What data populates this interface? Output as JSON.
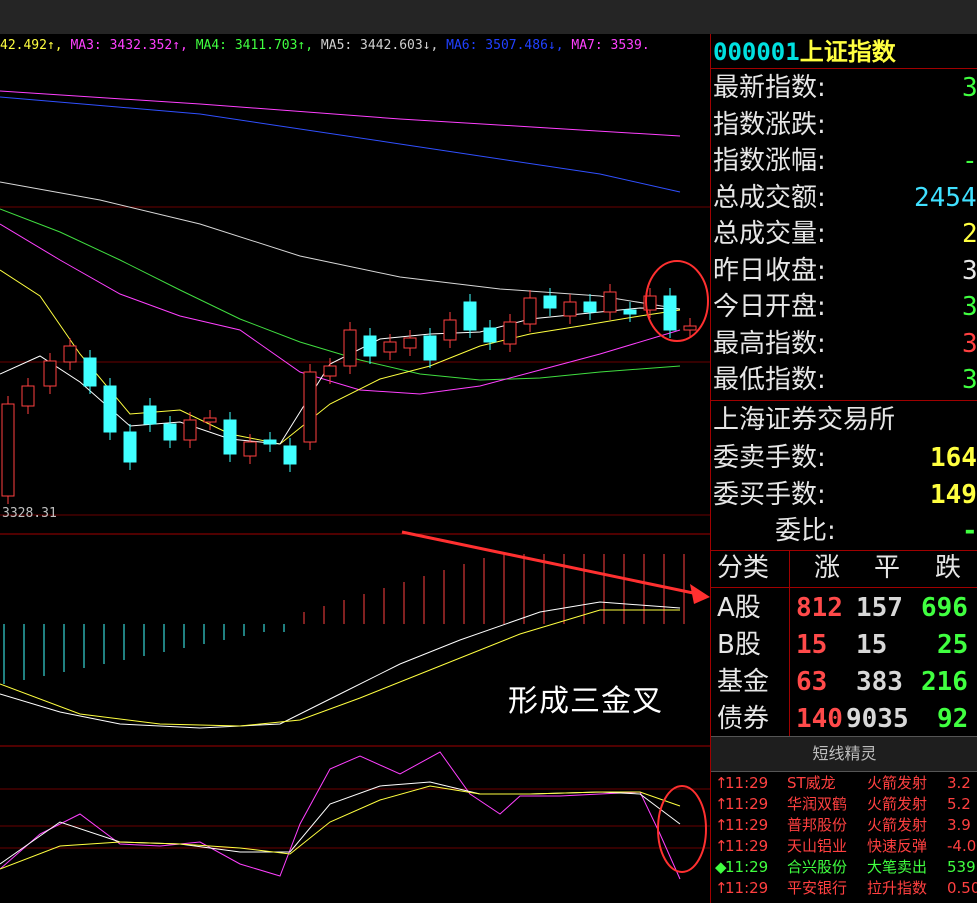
{
  "ma_legend": [
    {
      "text": "42.492↑, ",
      "color": "#ffff40"
    },
    {
      "text": "MA3: 3432.352↑, ",
      "color": "#ff40ff"
    },
    {
      "text": "MA4: 3411.703↑, ",
      "color": "#40ff40"
    },
    {
      "text": "MA5: 3442.603↓, ",
      "color": "#d0d0d0"
    },
    {
      "text": "MA6: 3507.486↓, ",
      "color": "#2040ff"
    },
    {
      "text": "MA7: 3539.",
      "color": "#ff40ff"
    }
  ],
  "chart": {
    "low_label": "3328.31",
    "annotation": "形成三金叉"
  },
  "quote": {
    "code": "000001",
    "name": "上证指数",
    "rows": [
      {
        "label": "最新指数:",
        "value": "3",
        "color": "#40ff40"
      },
      {
        "label": "指数涨跌:",
        "value": "",
        "color": "#40ff40"
      },
      {
        "label": "指数涨幅:",
        "value": "-",
        "color": "#40ff40"
      },
      {
        "label": "总成交额:",
        "value": "2454",
        "color": "#40e0ff"
      },
      {
        "label": "总成交量:",
        "value": "2",
        "color": "#ffff40"
      },
      {
        "label": "昨日收盘:",
        "value": "3",
        "color": "#e6e6e6"
      },
      {
        "label": "今日开盘:",
        "value": "3",
        "color": "#40ff40"
      },
      {
        "label": "最高指数:",
        "value": "3",
        "color": "#ff4040"
      },
      {
        "label": "最低指数:",
        "value": "3",
        "color": "#40ff40"
      }
    ],
    "exchange": "上海证券交易所",
    "orders": [
      {
        "label": "委卖手数:",
        "value": "164",
        "color": "#ffff40"
      },
      {
        "label": "委买手数:",
        "value": "149",
        "color": "#ffff40"
      },
      {
        "label": "委比:",
        "value": "-",
        "color": "#40ff40"
      }
    ]
  },
  "stats": {
    "headers": [
      "分类",
      "涨",
      "平",
      "跌"
    ],
    "rows": [
      {
        "label": "A股",
        "up": "812",
        "flat": "157",
        "down": "696"
      },
      {
        "label": "B股",
        "up": "15",
        "flat": "15",
        "down": "25"
      },
      {
        "label": "基金",
        "up": "63",
        "flat": "383",
        "down": "216"
      },
      {
        "label": "债券",
        "up": "140",
        "flat": "9035",
        "down": "92"
      }
    ]
  },
  "jingling": {
    "title": "短线精灵",
    "items": [
      {
        "marker": "↑",
        "time": "11:29",
        "stock": "ST威龙",
        "event": "火箭发射",
        "value": "3.2",
        "color": "#ff4040"
      },
      {
        "marker": "↑",
        "time": "11:29",
        "stock": "华润双鹤",
        "event": "火箭发射",
        "value": "5.2",
        "color": "#ff4040"
      },
      {
        "marker": "↑",
        "time": "11:29",
        "stock": "普邦股份",
        "event": "火箭发射",
        "value": "3.9",
        "color": "#ff4040"
      },
      {
        "marker": "↑",
        "time": "11:29",
        "stock": "天山铝业",
        "event": "快速反弹",
        "value": "-4.0",
        "color": "#ff4040"
      },
      {
        "marker": "◆",
        "time": "11:29",
        "stock": "合兴股份",
        "event": "大笔卖出",
        "value": "539",
        "color": "#40ff40"
      },
      {
        "marker": "↑",
        "time": "11:29",
        "stock": "平安银行",
        "event": "拉升指数",
        "value": "0.50",
        "color": "#ff4040"
      }
    ]
  }
}
